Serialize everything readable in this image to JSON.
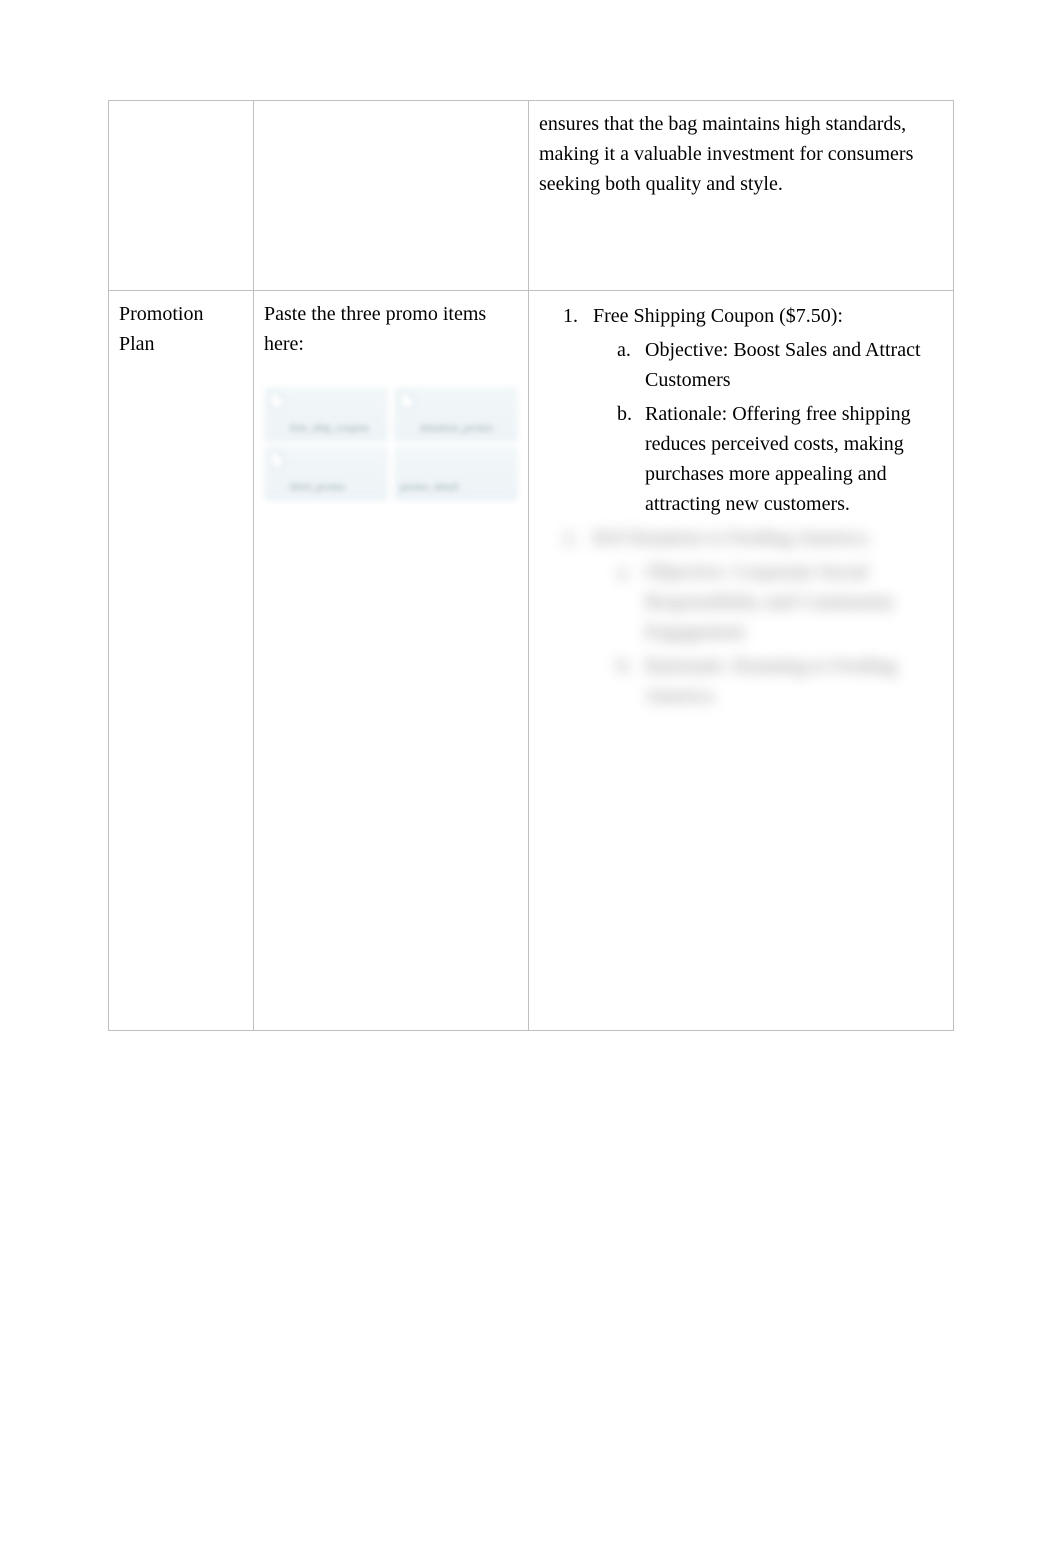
{
  "row1": {
    "col1": "",
    "col2": "",
    "col3": "ensures that the bag maintains high standards, making it a valuable investment for consumers seeking both quality and style."
  },
  "row2": {
    "label": "Promotion Plan",
    "instruction": "Paste the three promo items here:",
    "thumbs": {
      "t1": "free_ship_coupon",
      "t2": "donation_promo",
      "t3": "third_promo",
      "t4": "promo_detail"
    },
    "list": {
      "item1": {
        "title": "Free Shipping Coupon ($7.50):",
        "a_label": "Objective:",
        "a_text": "Boost Sales and Attract Customers",
        "b_label": "Rationale:",
        "b_text": "Offering free shipping reduces perceived costs, making purchases more appealing and attracting new customers."
      },
      "item2": {
        "title": "$10 Donation to Feeding America:",
        "a_label": "Objective:",
        "a_text": "Corporate Social Responsibility and Community Engagement",
        "b_label": "Rationale:",
        "b_text": "Donating to"
      },
      "hidden_tail": "Feeding America"
    }
  }
}
